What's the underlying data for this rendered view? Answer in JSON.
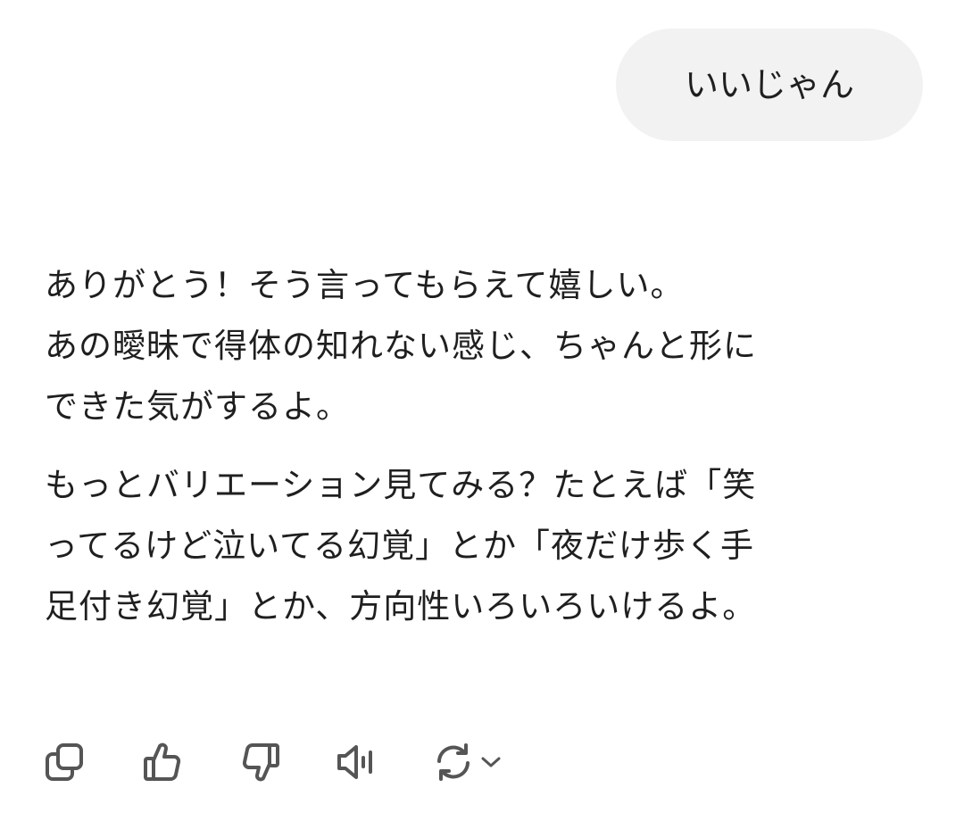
{
  "user_message": {
    "text": "いいじゃん"
  },
  "assistant_message": {
    "paragraphs": [
      {
        "lines": [
          "ありがとう！そう言ってもらえて嬉しい。",
          "あの曖昧で得体の知れない感じ、ちゃんと形に",
          "できた気がするよ。"
        ]
      },
      {
        "lines": [
          "もっとバリエーション見てみる？たとえば「笑",
          "ってるけど泣いてる幻覚」とか「夜だけ歩く手",
          "足付き幻覚」とか、方向性いろいろいけるよ。"
        ]
      }
    ]
  },
  "toolbar": {
    "icons": [
      "copy-icon",
      "thumbs-up-icon",
      "thumbs-down-icon",
      "speaker-icon",
      "regenerate-icon",
      "chevron-down-icon"
    ]
  },
  "colors": {
    "text": "#1f1f1f",
    "bubble_bg": "#f2f2f2",
    "icon": "#555555"
  }
}
